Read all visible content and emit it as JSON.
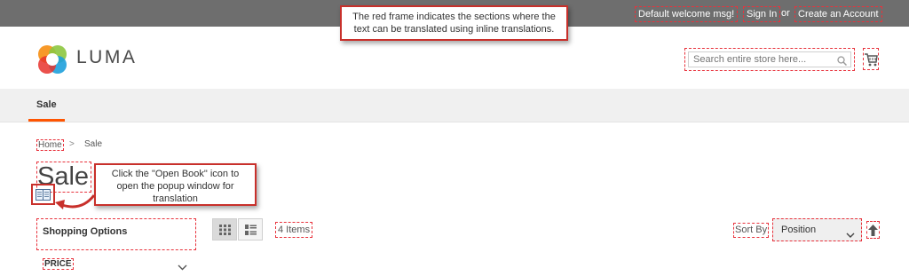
{
  "header": {
    "welcome": "Default welcome msg!",
    "sign_in": "Sign In",
    "or": "or",
    "create_account": "Create an Account"
  },
  "callouts": {
    "top_line1": "The red frame indicates the sections where the",
    "top_line2": "text can be translated using inline translations.",
    "book_line1": "Click the \"Open Book\" icon to",
    "book_line2": "open the popup window for",
    "book_line3": "translation"
  },
  "logo": {
    "text": "LUMA",
    "icon": "luma-logo-icon"
  },
  "search": {
    "placeholder": "Search entire store here...",
    "icon": "magnifier-icon"
  },
  "cart": {
    "icon": "cart-icon"
  },
  "nav": {
    "items": [
      {
        "label": "Sale"
      }
    ]
  },
  "breadcrumb": {
    "home": "Home",
    "separator": ">",
    "current": "Sale"
  },
  "page": {
    "title": "Sale",
    "translate_icon": "open-book-icon"
  },
  "sidebar": {
    "heading": "Shopping Options",
    "filters": [
      {
        "label": "PRICE"
      }
    ]
  },
  "toolbar": {
    "modes": [
      {
        "name": "grid",
        "icon": "grid-icon",
        "active": true
      },
      {
        "name": "list",
        "icon": "list-icon",
        "active": false
      }
    ],
    "count_label": "4 Items",
    "sort_label": "Sort By",
    "sort_value": "Position",
    "sort_direction_icon": "arrow-up-icon"
  },
  "colors": {
    "topbar": "#6e6e6e",
    "frame": "#e8323c",
    "callout_border": "#c8302b",
    "nav_accent": "#ff5501",
    "nav_bg": "#f0f0f0"
  }
}
